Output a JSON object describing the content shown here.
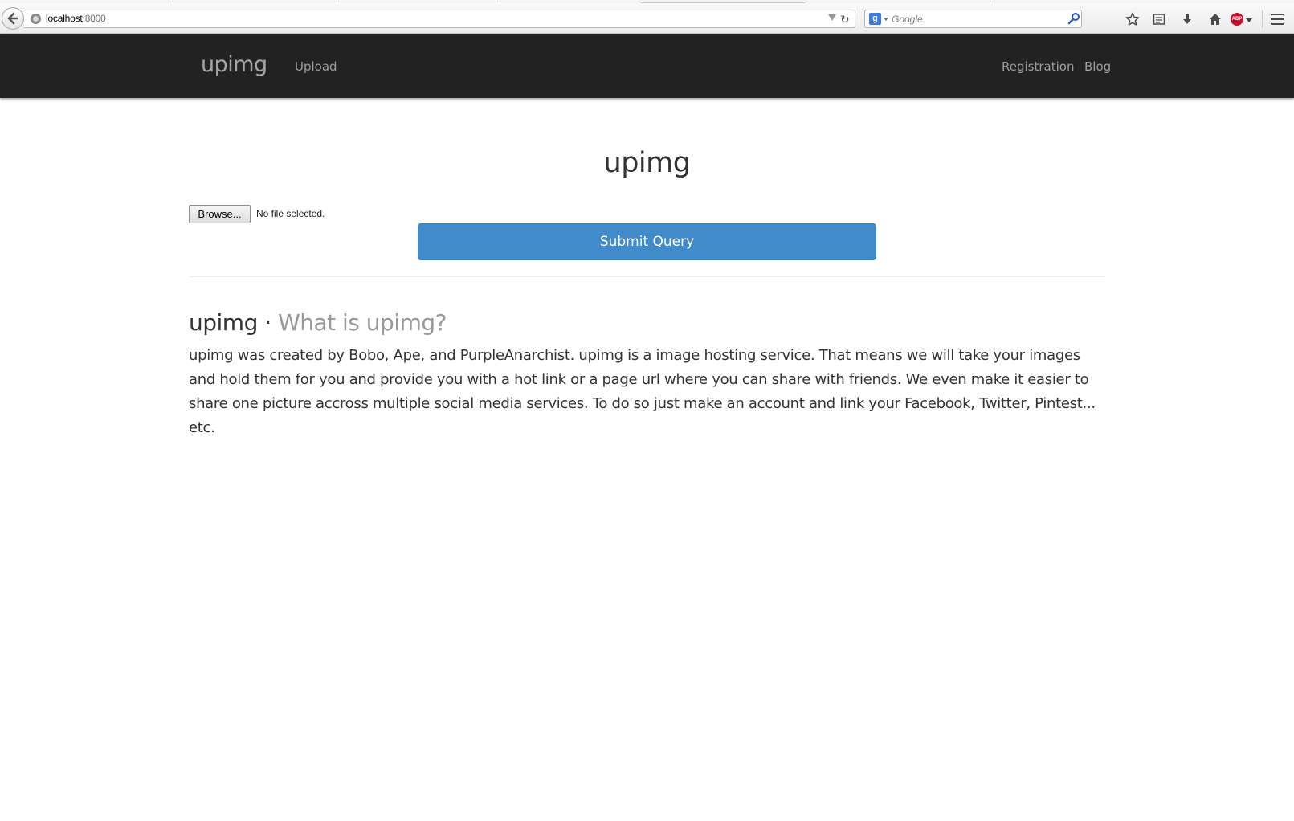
{
  "browser": {
    "url_host": "localhost",
    "url_port": ":8000",
    "search_placeholder": "Google",
    "search_engine_letter": "g",
    "adblock_label": "ABP"
  },
  "navbar": {
    "brand": "upimg",
    "left_links": [
      "Upload"
    ],
    "right_links": [
      "Registration",
      "Blog"
    ]
  },
  "upload": {
    "title": "upimg",
    "browse_label": "Browse...",
    "file_status": "No file selected.",
    "submit_label": "Submit Query"
  },
  "about": {
    "heading_main": "upimg",
    "heading_sep": " · ",
    "heading_sub": "What is upimg?",
    "body": "upimg was created by Bobo, Ape, and PurpleAnarchist. upimg is a image hosting service. That means we will take your images and hold them for you and provide you with a hot link or a page url where you can share with friends. We even make it easier to share one picture accross multiple social media services. To do so just make an account and link your Facebook, Twitter, Pintest... etc."
  },
  "colors": {
    "navbar_bg": "#222222",
    "nav_link": "#9d9d9d",
    "primary_button": "#428bca",
    "muted_text": "#999999"
  }
}
